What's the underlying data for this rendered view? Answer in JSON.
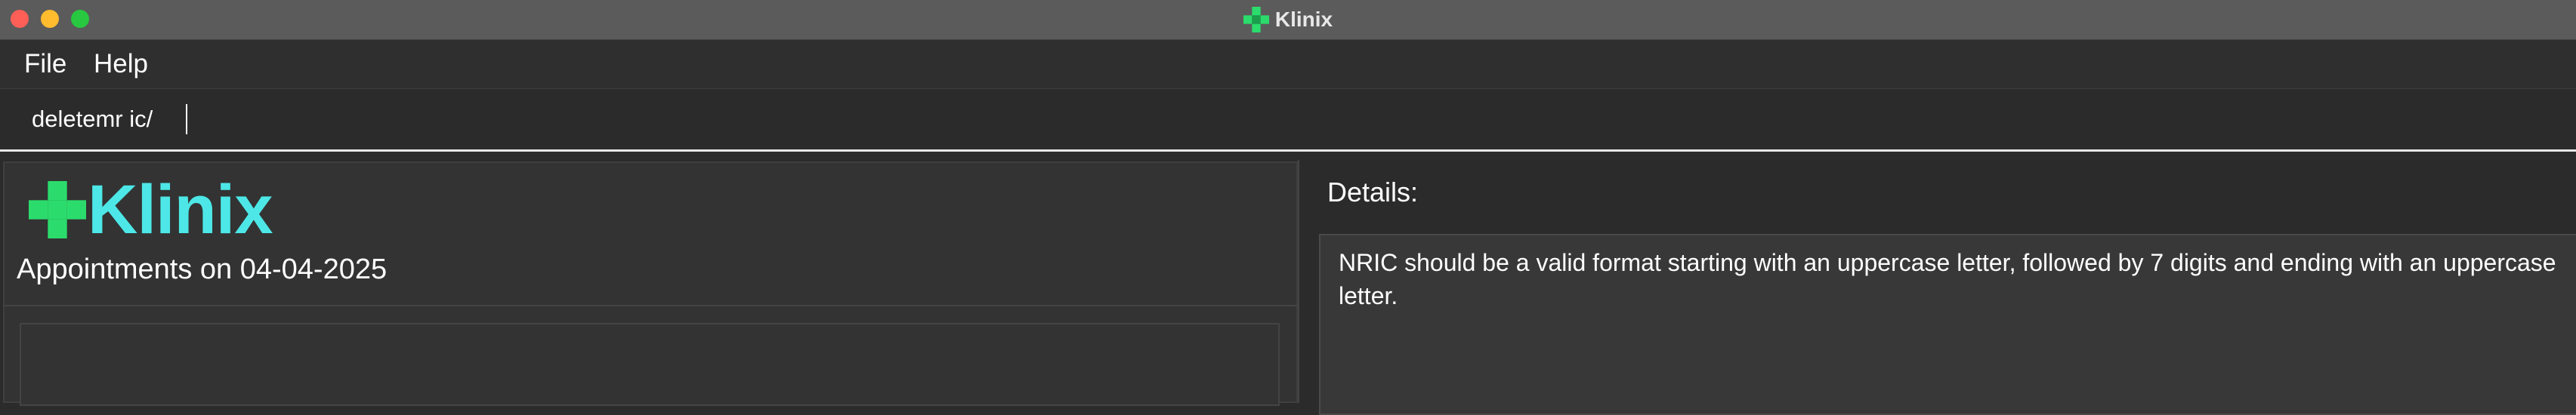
{
  "window": {
    "title": "Klinix",
    "icon": "green-cross-icon"
  },
  "menu": {
    "items": [
      {
        "label": "File"
      },
      {
        "label": "Help"
      }
    ]
  },
  "command_box": {
    "value": "deletemr ic/"
  },
  "left_panel": {
    "logo_text": "Klinix",
    "appointments_title": "Appointments on 04-04-2025"
  },
  "right_panel": {
    "details_label": "Details:",
    "details_text": "NRIC should be a valid format starting with an uppercase letter, followed by 7 digits and ending with an uppercase letter."
  },
  "colors": {
    "accent_green": "#2bdc6c",
    "logo_cyan": "#4de7e7",
    "background": "#2b2b2b"
  }
}
